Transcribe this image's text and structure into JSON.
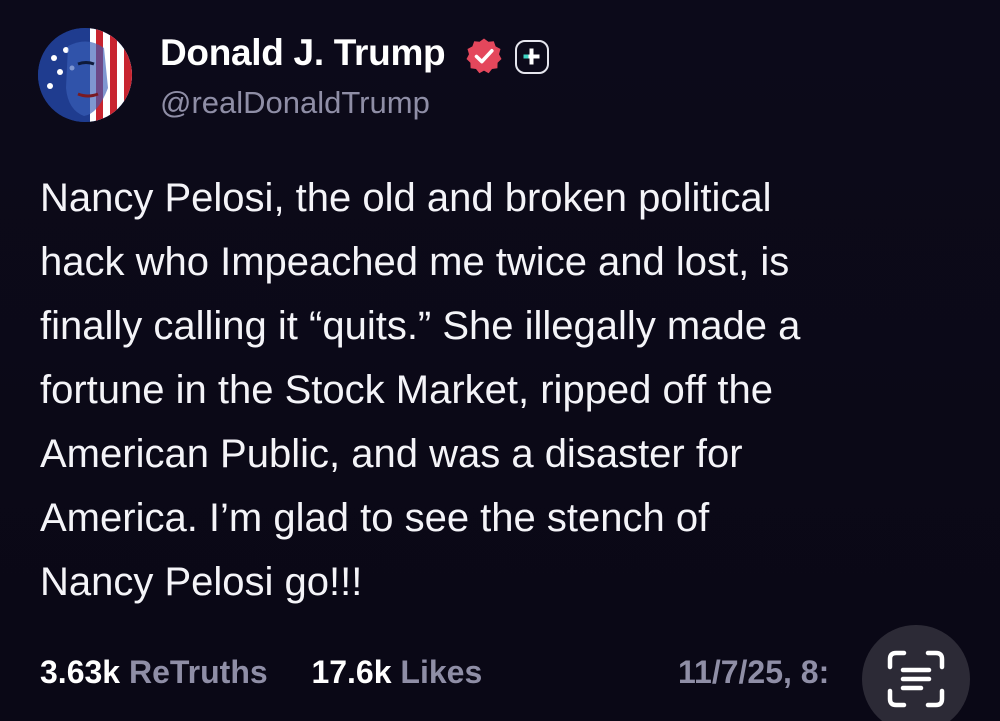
{
  "author": {
    "display_name": "Donald J. Trump",
    "handle": "@realDonaldTrump",
    "avatar_icon": "flag-portrait-avatar",
    "verified_icon": "verified-badge-icon",
    "verified_color": "#e4475c",
    "plus_icon": "plus-badge-icon"
  },
  "post": {
    "lines": [
      "Nancy Pelosi, the old and broken political",
      "hack who Impeached me twice and lost, is",
      "finally calling it “quits.” She illegally made a",
      "fortune in the Stock Market, ripped off the",
      "American Public, and was a disaster for",
      "America. I’m glad to see the stench of",
      "Nancy Pelosi go!!!"
    ]
  },
  "stats": {
    "retruths_count": "3.63k",
    "retruths_label": "ReTruths",
    "likes_count": "17.6k",
    "likes_label": "Likes",
    "timestamp": "11/7/25, 8:"
  },
  "overlay": {
    "scan_icon": "live-text-scan-icon"
  },
  "colors": {
    "background": "#0b0918",
    "text": "#f4f4f8",
    "muted": "#8f8ea6"
  }
}
